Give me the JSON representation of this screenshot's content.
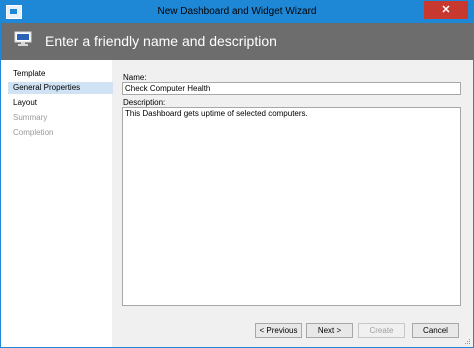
{
  "window": {
    "title": "New Dashboard and Widget Wizard",
    "close_glyph": "✕",
    "accent_color": "#1e88d6",
    "close_color": "#c7382f"
  },
  "header": {
    "title": "Enter a friendly name and description",
    "icon": "dashboard-monitor-icon",
    "background": "#6d6d6d"
  },
  "steps": [
    {
      "label": "Template",
      "state": "done"
    },
    {
      "label": "General Properties",
      "state": "current"
    },
    {
      "label": "Layout",
      "state": "next"
    },
    {
      "label": "Summary",
      "state": "disabled"
    },
    {
      "label": "Completion",
      "state": "disabled"
    }
  ],
  "form": {
    "name_label": "Name:",
    "name_value": "Check Computer Health",
    "description_label": "Description:",
    "description_value": "This Dashboard gets uptime of selected computers."
  },
  "buttons": {
    "previous": "< Previous",
    "next": "Next >",
    "create": "Create",
    "cancel": "Cancel"
  }
}
